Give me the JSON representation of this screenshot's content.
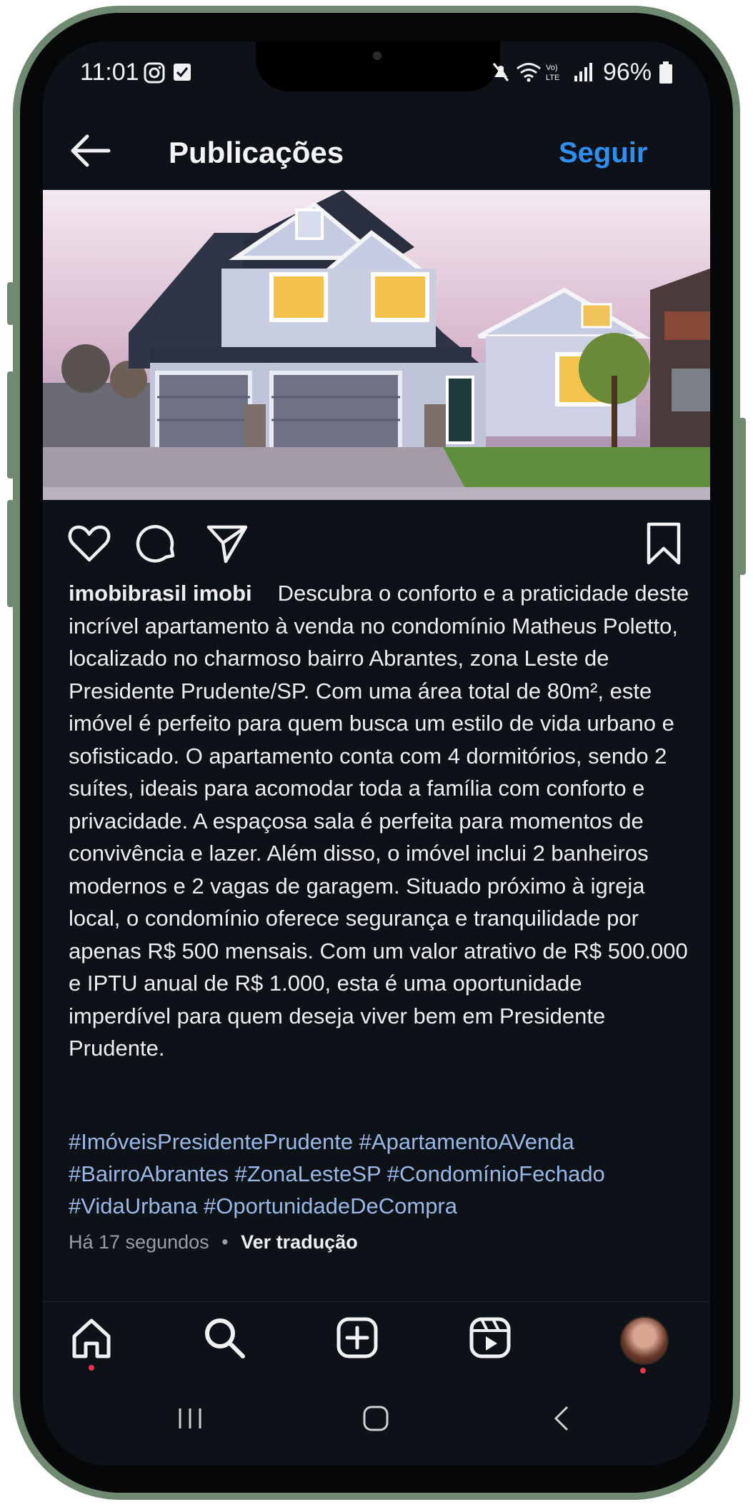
{
  "status_bar": {
    "time": "11:01",
    "battery": "96%",
    "left_icons": [
      "instagram-icon",
      "check-box-icon"
    ],
    "right_icons": [
      "mute-icon",
      "wifi-icon",
      "volte-icon",
      "signal-icon",
      "battery-icon"
    ]
  },
  "header": {
    "title": "Publicações",
    "follow_label": "Seguir"
  },
  "post": {
    "username": "imobibrasil imobi",
    "caption": "Descubra o conforto e a praticidade deste incrível apartamento à venda no condomínio Matheus Poletto, localizado no charmoso bairro Abrantes, zona Leste de Presidente Prudente/SP. Com uma área total de 80m², este imóvel é perfeito para quem busca um estilo de vida urbano e sofisticado. O apartamento conta com 4 dormitórios, sendo 2 suítes, ideais para acomodar toda a família com conforto e privacidade. A espaçosa sala é perfeita para momentos de convivência e lazer. Além disso, o imóvel inclui 2 banheiros modernos e 2 vagas de garagem. Situado próximo à igreja local, o condomínio oferece segurança e tranquilidade por apenas R$ 500 mensais. Com um valor atrativo de R$ 500.000 e IPTU anual de R$ 1.000, esta é uma oportunidade imperdível para quem deseja viver bem em Presidente Prudente.",
    "hashtags": "#ImóveisPresidentePrudente #ApartamentoAVenda #BairroAbrantes #ZonaLesteSP #CondomínioFechado #VidaUrbana #OportunidadeDeCompra",
    "time_ago": "Há 17 segundos",
    "separator": "•",
    "translate_label": "Ver tradução"
  },
  "colors": {
    "accent": "#2f8ff0",
    "hashtag": "#9ab8e6",
    "background": "#0d1218",
    "notification_dot": "#e8344e"
  }
}
